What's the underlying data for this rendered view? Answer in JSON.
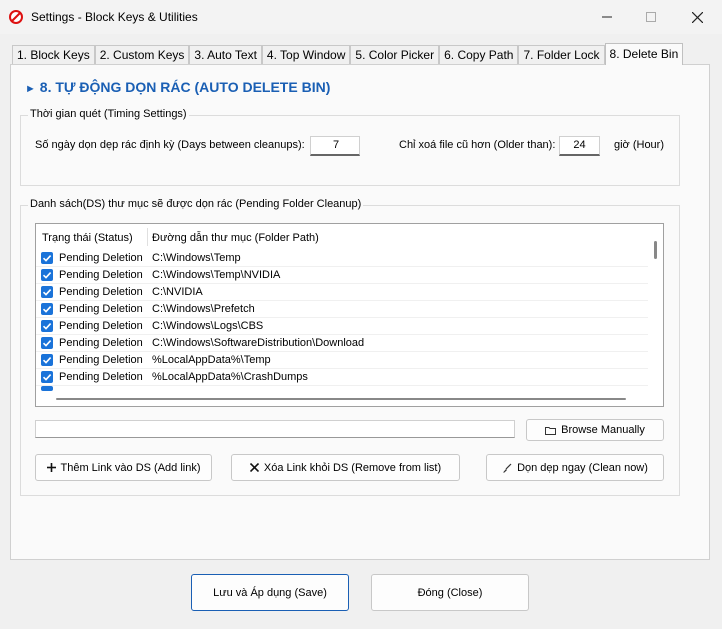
{
  "window": {
    "title": "Settings - Block Keys & Utilities",
    "icon": "prohibited-icon",
    "controls": [
      "minimize-icon",
      "maximize-icon",
      "close-icon"
    ]
  },
  "tabs": [
    {
      "label": "1. Block Keys"
    },
    {
      "label": "2. Custom Keys"
    },
    {
      "label": "3. Auto Text"
    },
    {
      "label": "4. Top Window"
    },
    {
      "label": "5. Color Picker"
    },
    {
      "label": "6. Copy Path"
    },
    {
      "label": "7. Folder Lock"
    },
    {
      "label": "8. Delete Bin",
      "active": true
    }
  ],
  "section": {
    "marker": "►",
    "title": "8. TỰ ĐỘNG DỌN RÁC (AUTO DELETE BIN)"
  },
  "timing": {
    "group_label": "Thời gian quét (Timing Settings)",
    "days_label": "Số ngày dọn dẹp rác định kỳ (Days between cleanups):",
    "days_value": "7",
    "older_label": "Chỉ xoá file cũ hơn (Older than):",
    "older_value": "24",
    "older_unit": "giờ (Hour)"
  },
  "pending": {
    "group_label": "Danh sách(DS) thư mục sẽ được dọn rác (Pending Folder Cleanup)",
    "columns": [
      "Trạng thái (Status)",
      "Đường dẫn thư mục (Folder Path)"
    ],
    "rows": [
      {
        "status": "Pending Deletion",
        "path": "C:\\Windows\\Temp",
        "checked": true
      },
      {
        "status": "Pending Deletion",
        "path": "C:\\Windows\\Temp\\NVIDIA",
        "checked": true
      },
      {
        "status": "Pending Deletion",
        "path": "C:\\NVIDIA",
        "checked": true
      },
      {
        "status": "Pending Deletion",
        "path": "C:\\Windows\\Prefetch",
        "checked": true
      },
      {
        "status": "Pending Deletion",
        "path": "C:\\Windows\\Logs\\CBS",
        "checked": true
      },
      {
        "status": "Pending Deletion",
        "path": "C:\\Windows\\SoftwareDistribution\\Download",
        "checked": true
      },
      {
        "status": "Pending Deletion",
        "path": "%LocalAppData%\\Temp",
        "checked": true
      },
      {
        "status": "Pending Deletion",
        "path": "%LocalAppData%\\CrashDumps",
        "checked": true
      }
    ],
    "path_input_value": "",
    "browse_label": "Browse Manually",
    "add_label": "Thêm Link vào DS (Add link)",
    "remove_label": "Xóa Link khỏi DS (Remove from list)",
    "clean_label": "Dọn dẹp ngay (Clean now)"
  },
  "footer": {
    "save_label": "Lưu và Áp dụng (Save)",
    "close_label": "Đóng (Close)"
  },
  "colors": {
    "accent": "#1a5fb4",
    "checkbox": "#1a73d9"
  }
}
